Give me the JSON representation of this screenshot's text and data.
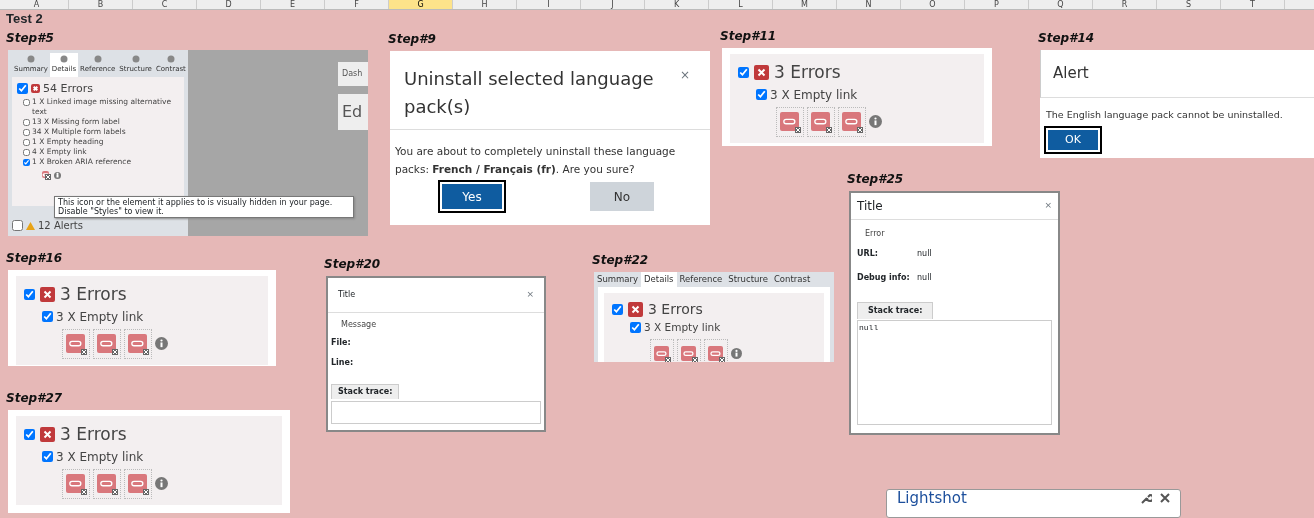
{
  "columns": [
    {
      "label": "A",
      "selected": false
    },
    {
      "label": "B",
      "selected": false
    },
    {
      "label": "C",
      "selected": false
    },
    {
      "label": "D",
      "selected": false
    },
    {
      "label": "E",
      "selected": false
    },
    {
      "label": "F",
      "selected": false
    },
    {
      "label": "G",
      "selected": true
    },
    {
      "label": "H",
      "selected": false
    },
    {
      "label": "I",
      "selected": false
    },
    {
      "label": "J",
      "selected": false
    },
    {
      "label": "K",
      "selected": false
    },
    {
      "label": "L",
      "selected": false
    },
    {
      "label": "M",
      "selected": false
    },
    {
      "label": "N",
      "selected": false
    },
    {
      "label": "O",
      "selected": false
    },
    {
      "label": "P",
      "selected": false
    },
    {
      "label": "Q",
      "selected": false
    },
    {
      "label": "R",
      "selected": false
    },
    {
      "label": "S",
      "selected": false
    },
    {
      "label": "T",
      "selected": false
    }
  ],
  "sheet_title": "Test 2",
  "snapshots": [
    {
      "label": "Step#5",
      "kind": "report",
      "tabs": [
        {
          "label": "Summary",
          "selected": false
        },
        {
          "label": "Details",
          "selected": true
        },
        {
          "label": "Reference",
          "selected": false
        },
        {
          "label": "Structure",
          "selected": false
        },
        {
          "label": "Contrast",
          "selected": false
        }
      ],
      "errors": {
        "label": "54 Errors",
        "checked": true
      },
      "items": [
        {
          "label": "1 X Linked image missing alternative text",
          "checked": false
        },
        {
          "label": "13 X Missing form label",
          "checked": false
        },
        {
          "label": "34 X Multiple form labels",
          "checked": false
        },
        {
          "label": "1 X Empty heading",
          "checked": false
        },
        {
          "label": "4 X Empty link",
          "checked": false
        },
        {
          "label": "1 X Broken ARIA reference",
          "checked": true
        }
      ],
      "tooltip": "This icon or the element it applies to is visually hidden in your page. Disable \"Styles\" to view it.",
      "alerts": {
        "label": "12 Alerts",
        "checked": false
      },
      "side_texts": [
        "Dash",
        "Ed"
      ]
    },
    {
      "label": "Step#9",
      "kind": "confirm",
      "title": "Uninstall selected language pack(s)",
      "close": "×",
      "message": "You are about to completely uninstall these language packs: **French / Français (fr)**. Are you sure?",
      "buttons": [
        {
          "label": "Yes",
          "selected": true
        },
        {
          "label": "No",
          "selected": false
        }
      ]
    },
    {
      "label": "Step#11",
      "kind": "errors",
      "errors": {
        "label": "3 Errors",
        "checked": true
      },
      "items": [
        {
          "label": "3 X Empty link",
          "checked": true
        }
      ]
    },
    {
      "label": "Step#14",
      "kind": "alert",
      "title": "Alert",
      "message": "The English language pack cannot be uninstalled.",
      "buttons": [
        {
          "label": "OK",
          "selected": true
        }
      ]
    },
    {
      "label": "Step#16",
      "kind": "errors",
      "errors": {
        "label": "3 Errors",
        "checked": true
      },
      "items": [
        {
          "label": "3 X Empty link",
          "checked": true
        }
      ]
    },
    {
      "label": "Step#20",
      "kind": "error_dialog",
      "title": "Title",
      "close": "×",
      "message": "Message",
      "fields": [
        {
          "label": "File:"
        },
        {
          "label": "Line:"
        }
      ],
      "trace_tab": "Stack trace:"
    },
    {
      "label": "Step#22",
      "kind": "errors",
      "tabs": [
        {
          "label": "Summary",
          "selected": false
        },
        {
          "label": "Details",
          "selected": true
        },
        {
          "label": "Reference",
          "selected": false
        },
        {
          "label": "Structure",
          "selected": false
        },
        {
          "label": "Contrast",
          "selected": false
        }
      ],
      "errors": {
        "label": "3 Errors",
        "checked": true
      },
      "items": [
        {
          "label": "3 X Empty link",
          "checked": true
        }
      ]
    },
    {
      "label": "Step#25",
      "kind": "error_dialog",
      "title": "Title",
      "close": "×",
      "message": "Error",
      "fields": [
        {
          "label": "URL:",
          "value": "null"
        },
        {
          "label": "Debug info:",
          "value": "null"
        }
      ],
      "trace_tab": "Stack trace:",
      "trace": "null"
    },
    {
      "label": "Step#27",
      "kind": "errors",
      "errors": {
        "label": "3 Errors",
        "checked": true
      },
      "items": [
        {
          "label": "3 X Empty link",
          "checked": true
        }
      ]
    }
  ],
  "lightshot": {
    "title": "Lightshot"
  }
}
